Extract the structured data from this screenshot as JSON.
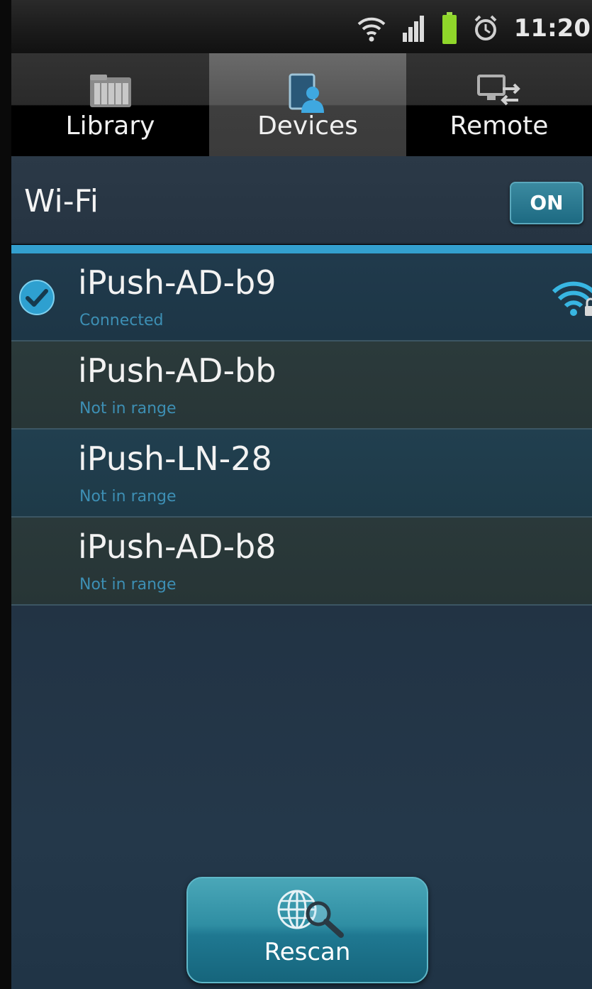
{
  "status_bar": {
    "time": "11:20",
    "icons": [
      "wifi-icon",
      "signal-bars-icon",
      "battery-icon",
      "alarm-icon"
    ],
    "battery_color": "#8fd62a"
  },
  "tabs": [
    {
      "label": "Library",
      "icon": "folder-icon",
      "selected": false
    },
    {
      "label": "Devices",
      "icon": "devices-icon",
      "selected": true
    },
    {
      "label": "Remote",
      "icon": "remote-icon",
      "selected": false
    }
  ],
  "wifi": {
    "title": "Wi-Fi",
    "toggle_label": "ON"
  },
  "networks": [
    {
      "name": "iPush-AD-b9",
      "status": "Connected",
      "connected": true
    },
    {
      "name": "iPush-AD-bb",
      "status": "Not in range",
      "connected": false
    },
    {
      "name": "iPush-LN-28",
      "status": "Not in range",
      "connected": false
    },
    {
      "name": "iPush-AD-b8",
      "status": "Not in range",
      "connected": false
    }
  ],
  "rescan": {
    "label": "Rescan",
    "icon": "globe-search-icon"
  },
  "colors": {
    "accent": "#33a0cf",
    "status_text": "#3d8fb4",
    "button": "#2f8ea3"
  }
}
